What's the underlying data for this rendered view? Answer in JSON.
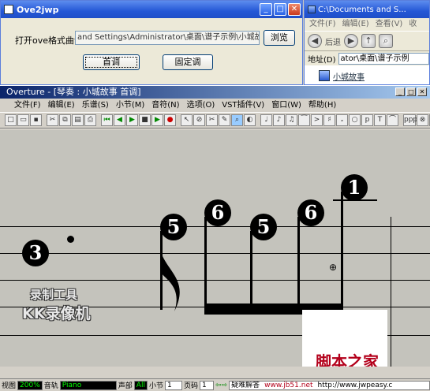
{
  "dialog": {
    "title": "Ove2jwp",
    "label": "打开ove格式曲谱",
    "path_value": "and Settings\\Administrator\\桌面\\谱子示例\\小城故事.ove",
    "browse_label": "浏览",
    "first_key_label": "首调",
    "fixed_key_label": "固定调"
  },
  "explorer": {
    "title": "C:\\Documents and S...",
    "menu": [
      "文件(F)",
      "编辑(E)",
      "查看(V)",
      "收"
    ],
    "back_label": "后退",
    "address_label": "地址(D)",
    "address_value": "ator\\桌面\\谱子示例",
    "file_name": "小城故事"
  },
  "overture": {
    "title": "Overture - [琴奏 : 小城故事 首调]",
    "menu": [
      "文件(F)",
      "编辑(E)",
      "乐谱(S)",
      "小节(M)",
      "音符(N)",
      "选项(O)",
      "VST插件(V)",
      "窗口(W)",
      "帮助(H)"
    ],
    "notes": [
      "3",
      "5",
      "6",
      "5",
      "6",
      "1"
    ],
    "watermark_line1": "录制工具",
    "watermark_line2": "KK录像机",
    "site_watermark": "脚本之家",
    "site_url": "www.jb51.net"
  },
  "status": {
    "view_label": "视图",
    "zoom_value": "200%",
    "track_label": "音轨",
    "instrument_value": "Piano",
    "voice_label": "声部",
    "voice_value": "All",
    "measure_label": "小节",
    "measure_value": "1",
    "page_label": "页码",
    "page_value": "1",
    "help_label": "疑难解答",
    "url_value": "http://www.jwpeasy.c"
  }
}
